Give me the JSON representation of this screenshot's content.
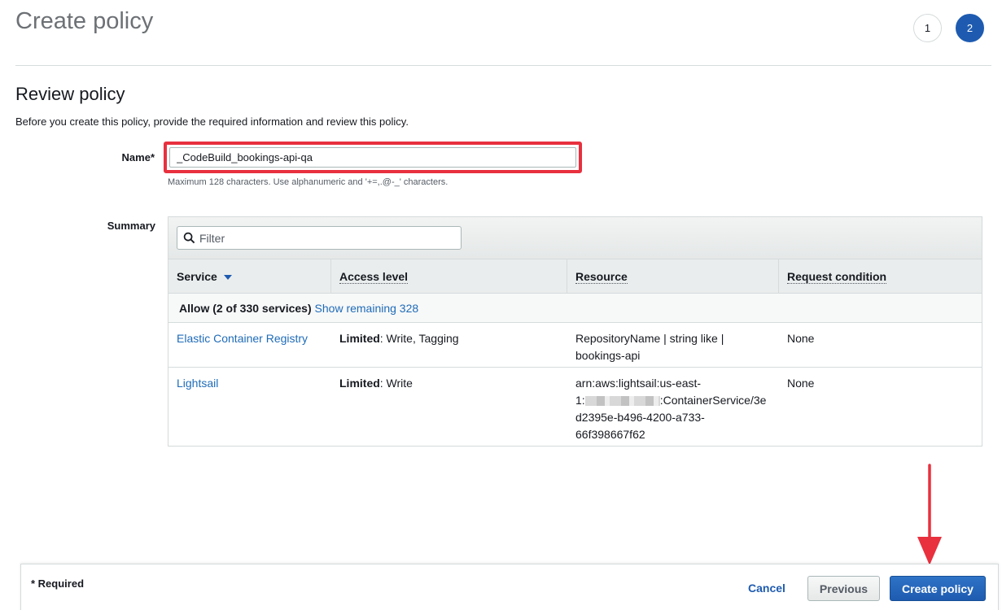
{
  "header": {
    "title": "Create policy",
    "steps": [
      "1",
      "2"
    ],
    "active_step": "2"
  },
  "review": {
    "title": "Review policy",
    "description": "Before you create this policy, provide the required information and review this policy."
  },
  "name_field": {
    "label": "Name*",
    "value": "_CodeBuild_bookings-api-qa",
    "hint": "Maximum 128 characters. Use alphanumeric and '+=,.@-_' characters."
  },
  "summary": {
    "label": "Summary",
    "filter_placeholder": "Filter",
    "columns": [
      "Service",
      "Access level",
      "Resource",
      "Request condition"
    ],
    "group": {
      "label": "Allow (2 of 330 services)",
      "link": "Show remaining 328"
    },
    "rows": [
      {
        "service": "Elastic Container Registry",
        "access_bold": "Limited",
        "access_rest": ": Write, Tagging",
        "resource_line1": "RepositoryName | string like |",
        "resource_line2": "bookings-api",
        "condition": "None"
      },
      {
        "service": "Lightsail",
        "access_bold": "Limited",
        "access_rest": ": Write",
        "resource_line1": "arn:aws:lightsail:us-east-",
        "resource_line2_prefix": "1:",
        "resource_line2_suffix": ":ContainerService/3e",
        "resource_line3": "d2395e-b496-4200-a733-",
        "resource_line4": "66f398667f62",
        "condition": "None"
      }
    ]
  },
  "footer": {
    "required_note": "* Required",
    "cancel": "Cancel",
    "previous": "Previous",
    "create": "Create policy"
  },
  "colors": {
    "primary": "#1e5bb0",
    "highlight": "#e8303e",
    "link": "#1e6bb8"
  }
}
